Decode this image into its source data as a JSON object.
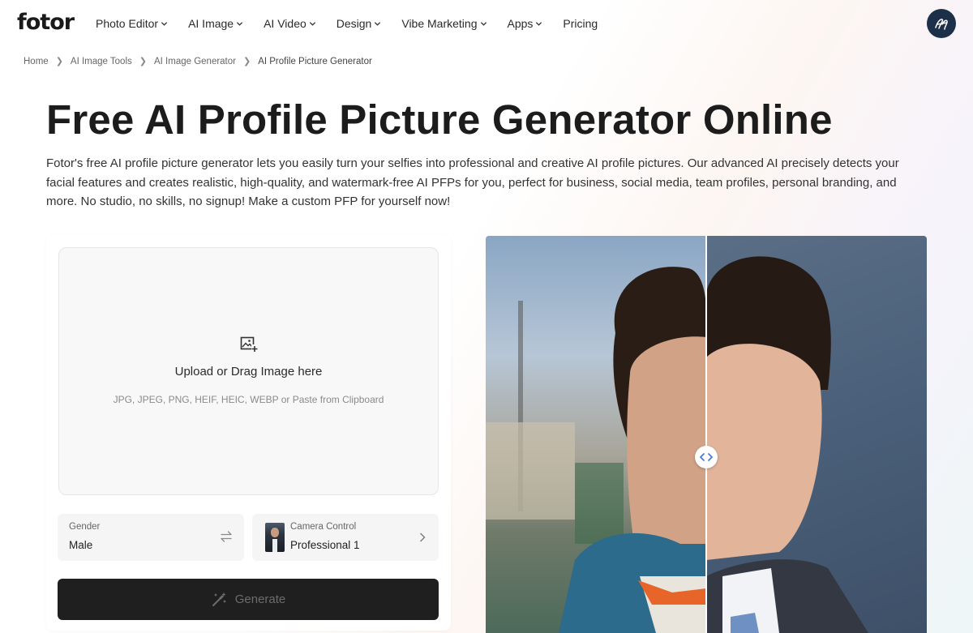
{
  "header": {
    "logo": "fotor",
    "nav": [
      {
        "label": "Photo Editor",
        "has_dropdown": true
      },
      {
        "label": "AI Image",
        "has_dropdown": true
      },
      {
        "label": "AI Video",
        "has_dropdown": true
      },
      {
        "label": "Design",
        "has_dropdown": true
      },
      {
        "label": "Vibe Marketing",
        "has_dropdown": true
      },
      {
        "label": "Apps",
        "has_dropdown": true
      },
      {
        "label": "Pricing",
        "has_dropdown": false
      }
    ],
    "profile_icon": "user-avatar-icon"
  },
  "breadcrumb": [
    "Home",
    "AI Image Tools",
    "AI Image Generator",
    "AI Profile Picture Generator"
  ],
  "hero": {
    "title": "Free AI Profile Picture Generator Online",
    "description": "Fotor's free AI profile picture generator lets you easily turn your selfies into professional and creative AI profile pictures. Our advanced AI precisely detects your facial features and creates realistic, high-quality, and watermark-free AI PFPs for you, perfect for business, social media, team profiles, personal branding, and more. No studio, no skills, no signup! Make a custom PFP for yourself now!"
  },
  "upload": {
    "icon": "image-add-icon",
    "title": "Upload or Drag Image here",
    "formats": "JPG, JPEG, PNG, HEIF, HEIC, WEBP or Paste from Clipboard"
  },
  "options": {
    "gender": {
      "label": "Gender",
      "value": "Male",
      "icon": "swap-icon"
    },
    "camera": {
      "label": "Camera Control",
      "value": "Professional 1",
      "icon": "chevron-right-icon"
    }
  },
  "generate": {
    "label": "Generate",
    "icon": "magic-wand-icon"
  },
  "compare": {
    "handle_icon": "compare-slider-icon",
    "position": 0.5
  },
  "colors": {
    "accent_dark": "#1f1f1f",
    "badge": "#1d3049",
    "handle": "#4a7bd6"
  }
}
